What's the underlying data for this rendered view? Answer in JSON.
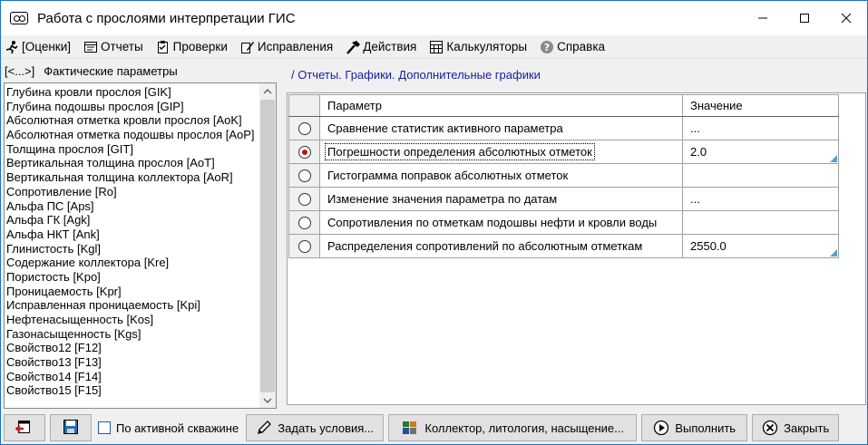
{
  "window": {
    "title": "Работа с прослоями интерпретации ГИС"
  },
  "window_controls": {
    "minimize": "—",
    "maximize": "☐",
    "close": "✕"
  },
  "menu": [
    {
      "label": "[Оценки]",
      "icon": "running-figure-icon"
    },
    {
      "label": "Отчеты",
      "icon": "report-icon"
    },
    {
      "label": "Проверки",
      "icon": "checklist-icon"
    },
    {
      "label": "Исправления",
      "icon": "edit-icon"
    },
    {
      "label": "Действия",
      "icon": "hammer-icon"
    },
    {
      "label": "Калькуляторы",
      "icon": "calculator-icon"
    },
    {
      "label": "Справка",
      "icon": "help-icon"
    }
  ],
  "left_panel": {
    "back_label": "[<...>]",
    "title": "Фактические параметры",
    "items": [
      "Глубина кровли прослоя [GIK]",
      "Глубина подошвы прослоя [GIP]",
      "Абсолютная отметка кровли прослоя [AoK]",
      "Абсолютная отметка подошвы прослоя [AoP]",
      "Толщина прослоя [GIT]",
      "Вертикальная толщина прослоя [AoT]",
      "Вертикальная толщина коллектора [AoR]",
      "Сопротивление [Ro]",
      "Альфа ПС [Aps]",
      "Альфа ГК [Agk]",
      "Альфа НКТ [Ank]",
      "Глинистость [Kgl]",
      "Содержание коллектора [Kre]",
      "Пористость [Kpo]",
      "Проницаемость [Kpr]",
      "Исправленная проницаемость [Kpi]",
      "Нефтенасыщенность [Kos]",
      "Газонасыщенность [Kgs]",
      "Свойство12 [F12]",
      "Свойство13 [F13]",
      "Свойство14 [F14]",
      "Свойство15 [F15]"
    ]
  },
  "breadcrumb": "/ Отчеты. Графики. Дополнительные графики",
  "grid": {
    "headers": [
      "Параметр",
      "Значение"
    ],
    "rows": [
      {
        "param": "Сравнение статистик активного параметра",
        "value": "...",
        "selected": false,
        "editable": false
      },
      {
        "param": "Погрешности определения абсолютных отметок",
        "value": "2.0",
        "selected": true,
        "editable": true
      },
      {
        "param": "Гистограмма поправок абсолютных отметок",
        "value": "",
        "selected": false,
        "editable": false
      },
      {
        "param": "Изменение значения параметра по датам",
        "value": "...",
        "selected": false,
        "editable": false
      },
      {
        "param": "Сопротивления по отметкам подошвы нефти и кровли воды",
        "value": "",
        "selected": false,
        "editable": false
      },
      {
        "param": "Распределения сопротивлений по абсолютным отметкам",
        "value": "2550.0",
        "selected": false,
        "editable": true
      }
    ]
  },
  "bottom": {
    "checkbox_label": "По активной скважине",
    "set_conditions": "Задать условия...",
    "collector": "Коллектор, литология, насыщение...",
    "execute": "Выполнить",
    "close": "Закрыть"
  },
  "colors": {
    "window_border": "#1a73c9",
    "breadcrumb": "#1a1aa6",
    "radio_dot": "#b01818",
    "corner_mark": "#5ba3c9"
  }
}
